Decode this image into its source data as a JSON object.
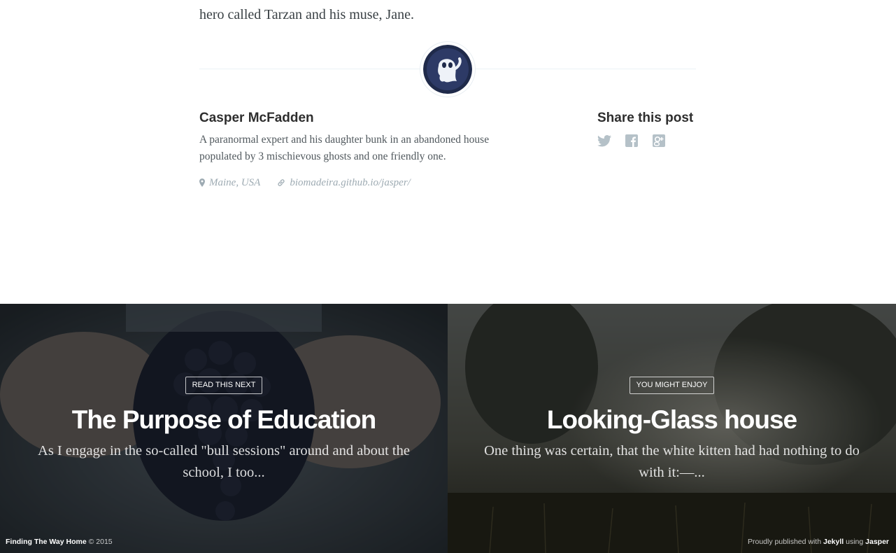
{
  "article": {
    "closing_line": "hero called Tarzan and his muse, Jane."
  },
  "author": {
    "avatar_icon": "ghost-avatar",
    "name": "Casper McFadden",
    "bio_line1": "A paranormal expert and his daughter bunk in an abandoned house",
    "bio_line2": "populated by 3 mischievous ghosts and one friendly one.",
    "location": "Maine, USA",
    "website": "biomadeira.github.io/jasper/"
  },
  "share": {
    "title": "Share this post",
    "icons": [
      "twitter-icon",
      "facebook-icon",
      "google-plus-icon"
    ]
  },
  "read_next": [
    {
      "tag": "Read this next",
      "title": "The Purpose of Education",
      "excerpt": "As I engage in the so-called \"bull sessions\" around and about the school, I too..."
    },
    {
      "tag": "You might enjoy",
      "title": "Looking-Glass house",
      "excerpt": "One thing was certain, that the white kitten had had nothing to do with it:—..."
    }
  ],
  "footer": {
    "site_name": "Finding The Way Home",
    "copyright": "© 2015",
    "published_prefix": "Proudly published with",
    "engine": "Jekyll",
    "using": "using",
    "theme": "Jasper"
  },
  "colors": {
    "text": "#3a4145",
    "muted": "#9eabb3",
    "share_icon": "#b5c1c8"
  }
}
